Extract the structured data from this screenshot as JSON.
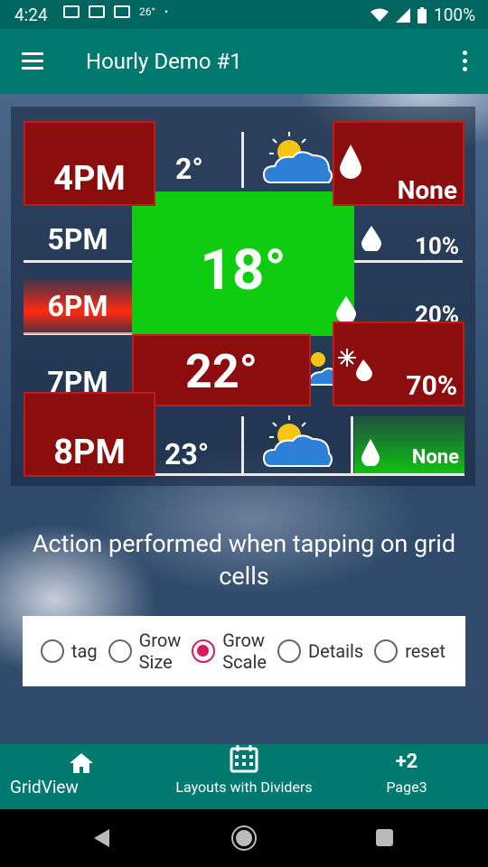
{
  "status": {
    "time": "4:24",
    "temp": "26°",
    "battery": "100%"
  },
  "appbar": {
    "title": "Hourly Demo #1"
  },
  "grid": {
    "times": [
      "4PM",
      "5PM",
      "6PM",
      "7PM",
      "8PM"
    ],
    "temps": [
      "2°",
      "18°",
      "22°",
      "23°"
    ],
    "precip": [
      "None",
      "10%",
      "20%",
      "70%",
      "None"
    ]
  },
  "description": "Action performed when tapping on grid cells",
  "radios": [
    {
      "label": "tag",
      "checked": false
    },
    {
      "label": "Grow\nSize",
      "checked": false
    },
    {
      "label": "Grow\nScale",
      "checked": true
    },
    {
      "label": "Details",
      "checked": false
    },
    {
      "label": "reset",
      "checked": false
    }
  ],
  "bottom_nav": [
    {
      "label": "GridView",
      "icon": "home-icon"
    },
    {
      "label": "Layouts with Dividers",
      "icon": "calendar-icon"
    },
    {
      "label": "Page3",
      "badge": "+2"
    }
  ],
  "colors": {
    "teal": "#00796e",
    "dark_teal": "#00665f",
    "accent": "#d81b60",
    "green": "#10cc10",
    "dark_red": "#8b0d0d"
  }
}
